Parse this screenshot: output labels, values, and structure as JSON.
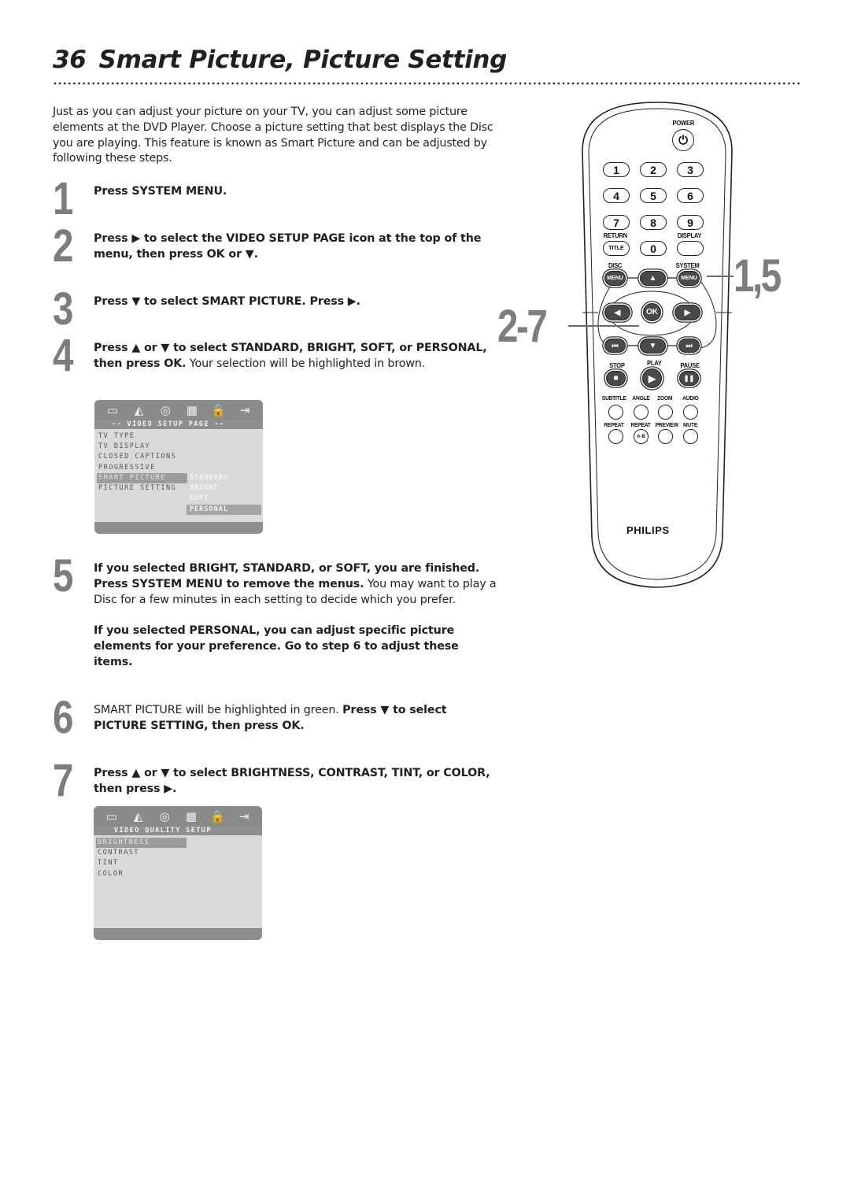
{
  "page": {
    "number": "36",
    "title": "Smart Picture, Picture Setting",
    "intro": "Just as you can adjust your picture on your TV, you can adjust some picture elements at the DVD Player. Choose a picture setting that best displays the Disc you are playing. This feature is known as Smart Picture and can be adjusted by following these steps."
  },
  "steps": [
    {
      "number": "1",
      "parts": [
        {
          "t": "Press SYSTEM MENU.",
          "b": true
        }
      ]
    },
    {
      "number": "2",
      "parts": [
        {
          "t": "Press ▶ to select the VIDEO SETUP PAGE icon at the top of the menu, then press OK or ▼.",
          "b": true
        }
      ]
    },
    {
      "number": "3",
      "parts": [
        {
          "t": "Press ▼ to select SMART PICTURE. Press ▶.",
          "b": true
        }
      ]
    },
    {
      "number": "4",
      "parts": [
        {
          "t": "Press ▲ or ▼ to select STANDARD, BRIGHT,  SOFT, or PERSONAL, then press OK.",
          "b": true
        },
        {
          "t": " Your selection will be highlighted in brown.",
          "b": false
        }
      ]
    },
    {
      "number": "5",
      "parts": [
        {
          "t": "If you selected BRIGHT, STANDARD, or SOFT, you are finished. Press SYSTEM MENU to remove the menus.",
          "b": true
        },
        {
          "t": " You may want to play a Disc for a few minutes in each setting to decide which you prefer.",
          "b": false
        }
      ],
      "extra": "If you selected PERSONAL, you can adjust specific picture elements for your preference. Go to step 6 to adjust these items."
    },
    {
      "number": "6",
      "parts": [
        {
          "t": "SMART PICTURE will be highlighted in green. ",
          "b": false
        },
        {
          "t": "Press ▼ to select PICTURE SETTING, then press OK.",
          "b": true
        }
      ]
    },
    {
      "number": "7",
      "parts": [
        {
          "t": "Press ▲ or ▼ to select BRIGHTNESS, CONTRAST, TINT, or COLOR, then press ▶.",
          "b": true
        }
      ]
    }
  ],
  "osd_video_setup": {
    "icons": [
      "tv-screen-icon",
      "speaker-icon",
      "disc-icon",
      "picture-icon",
      "lock-icon",
      "exit-icon"
    ],
    "icon_glyphs": [
      "▭",
      "◭",
      "◎",
      "▦",
      "🔒",
      "⇥"
    ],
    "header": "-- VIDEO SETUP PAGE --",
    "items": [
      "TV TYPE",
      "TV DISPLAY",
      "CLOSED CAPTIONS",
      "PROGRESSIVE",
      "SMART PICTURE",
      "PICTURE SETTING"
    ],
    "selected_item": "SMART PICTURE",
    "sub_options": [
      "STANDARD",
      "BRIGHT",
      "SOFT",
      "PERSONAL"
    ],
    "selected_sub": "PERSONAL"
  },
  "osd_video_quality": {
    "icons": [
      "tv-screen-icon",
      "speaker-icon",
      "disc-icon",
      "picture-icon",
      "lock-icon",
      "exit-icon"
    ],
    "icon_glyphs": [
      "▭",
      "◭",
      "◎",
      "▦",
      "🔒",
      "⇥"
    ],
    "header": "VIDEO QUALITY SETUP",
    "items": [
      "BRIGHTNESS",
      "CONTRAST",
      "TINT",
      "COLOR"
    ],
    "selected_item": "BRIGHTNESS"
  },
  "remote": {
    "brand": "PHILIPS",
    "labels": {
      "power": "POWER",
      "return": "RETURN",
      "display": "DISPLAY",
      "disc": "DISC",
      "system": "SYSTEM",
      "stop": "STOP",
      "play": "PLAY",
      "pause": "PAUSE",
      "subtitle": "SUBTITLE",
      "angle": "ANGLE",
      "zoom": "ZOOM",
      "audio": "AUDIO",
      "repeat": "REPEAT",
      "repeat_ab": "REPEAT",
      "preview": "PREVIEW",
      "mute": "MUTE"
    },
    "digits": [
      "1",
      "2",
      "3",
      "4",
      "5",
      "6",
      "7",
      "8",
      "9"
    ],
    "zero": "0",
    "title_btn": "TITLE",
    "menu_btn": "MENU",
    "ok_btn": "OK",
    "ab_btn": "A-B",
    "glyphs": {
      "up": "▲",
      "down": "▼",
      "left": "◀",
      "right": "▶",
      "prev": "⏮",
      "next": "⏭",
      "stop": "■",
      "play": "▶",
      "pause": "❚❚",
      "power": "⏻"
    }
  },
  "callouts": {
    "system_menu_steps": "1,5",
    "nav_steps": "2-7"
  },
  "colors": {
    "step_number": "#7d7d7d",
    "text": "#231f20",
    "osd_bar": "#8a8a8a",
    "osd_bg": "#d9d9d9"
  }
}
